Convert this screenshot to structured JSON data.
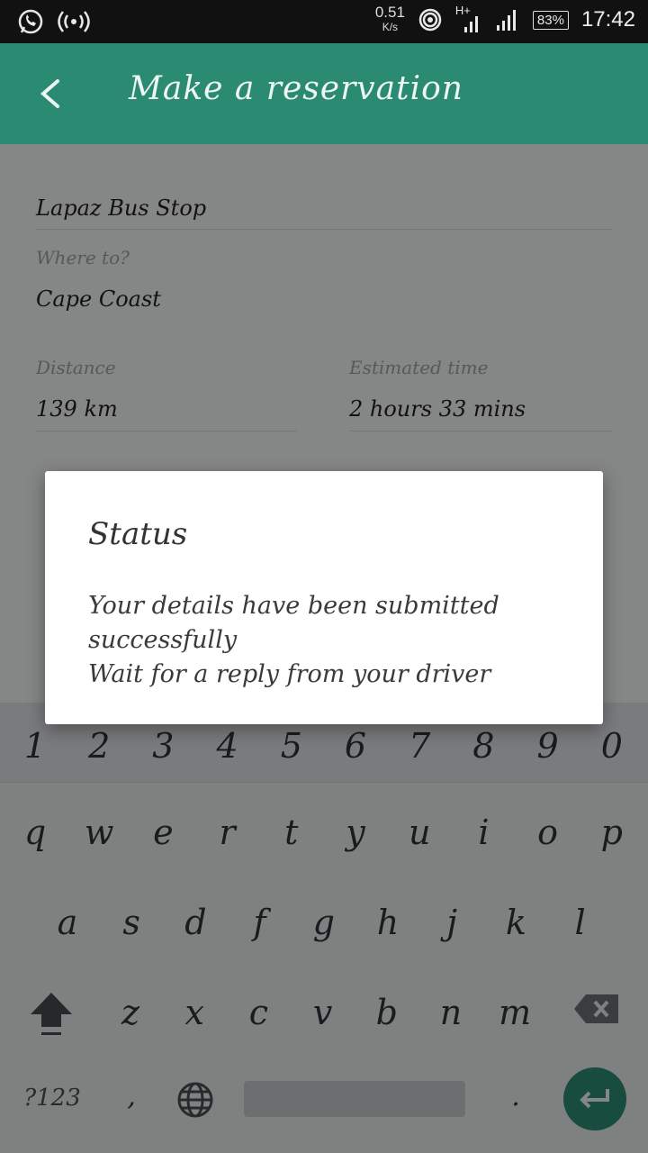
{
  "status_bar": {
    "speed_value": "0.51",
    "speed_unit": "K/s",
    "network": "H+",
    "battery": "83%",
    "time": "17:42"
  },
  "app_bar": {
    "title": "Make a reservation",
    "back_icon": "arrow-left-icon"
  },
  "form": {
    "origin_value": "Lapaz Bus Stop",
    "destination_label": "Where to?",
    "destination_value": "Cape Coast",
    "distance_label": "Distance",
    "distance_value": "139 km",
    "estimated_time_label": "Estimated time",
    "estimated_time_value": "2 hours 33 mins"
  },
  "dialog": {
    "title": "Status",
    "message_line1": "Your details have been submitted successfully",
    "message_line2": "Wait for a reply from your driver"
  },
  "keyboard": {
    "numbers": [
      "1",
      "2",
      "3",
      "4",
      "5",
      "6",
      "7",
      "8",
      "9",
      "0"
    ],
    "row1": [
      "q",
      "w",
      "e",
      "r",
      "t",
      "y",
      "u",
      "i",
      "o",
      "p"
    ],
    "row2": [
      "a",
      "s",
      "d",
      "f",
      "g",
      "h",
      "j",
      "k",
      "l"
    ],
    "row3": [
      "z",
      "x",
      "c",
      "v",
      "b",
      "n",
      "m"
    ],
    "symbols_key": "?123",
    "comma_key": ",",
    "period_key": ".",
    "accent": "#2a8a72"
  }
}
